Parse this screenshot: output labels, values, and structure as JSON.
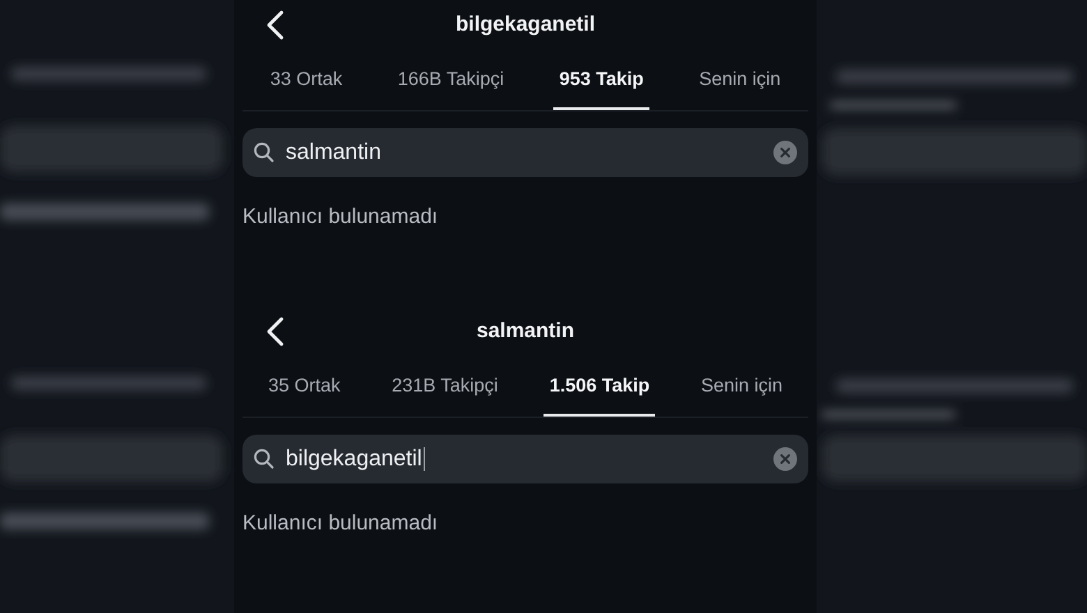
{
  "screens": [
    {
      "title": "bilgekaganetil",
      "tabs": [
        {
          "label": "33 Ortak",
          "selected": false
        },
        {
          "label": "166B Takipçi",
          "selected": false
        },
        {
          "label": "953 Takip",
          "selected": true
        },
        {
          "label": "Senin için",
          "selected": false
        }
      ],
      "search": {
        "value": "salmantin",
        "focused": false
      },
      "message": "Kullanıcı bulunamadı"
    },
    {
      "title": "salmantin",
      "tabs": [
        {
          "label": "35 Ortak",
          "selected": false
        },
        {
          "label": "231B Takipçi",
          "selected": false
        },
        {
          "label": "1.506 Takip",
          "selected": true
        },
        {
          "label": "Senin için",
          "selected": false
        }
      ],
      "search": {
        "value": "bilgekaganetil",
        "focused": true
      },
      "message": "Kullanıcı bulunamadı"
    }
  ]
}
